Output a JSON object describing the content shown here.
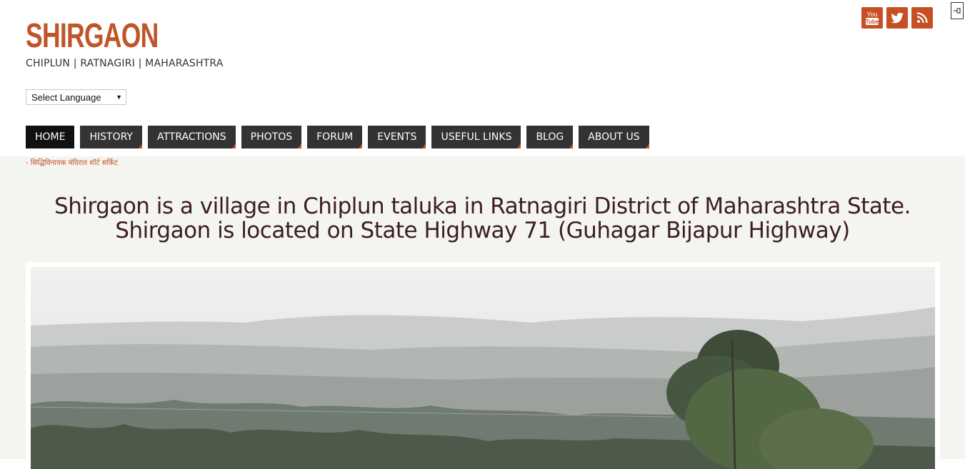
{
  "header": {
    "site_title": "SHIRGAON",
    "tagline": "CHIPLUN | RATNAGIRI | MAHARASHTRA",
    "language_select": {
      "selected": "Select Language"
    },
    "social": [
      {
        "icon": "youtube-icon",
        "label": "You Tube"
      },
      {
        "icon": "twitter-icon"
      },
      {
        "icon": "rss-icon"
      }
    ]
  },
  "nav": {
    "items": [
      {
        "label": "HOME",
        "active": true
      },
      {
        "label": "HISTORY"
      },
      {
        "label": "ATTRACTIONS"
      },
      {
        "label": "PHOTOS"
      },
      {
        "label": "FORUM"
      },
      {
        "label": "EVENTS"
      },
      {
        "label": "USEFUL LINKS"
      },
      {
        "label": "BLOG"
      },
      {
        "label": "ABOUT US"
      }
    ]
  },
  "ticker": {
    "text": "- सिद्धिविनायक मंदिरात शॉर्ट सर्किट"
  },
  "main": {
    "headline_line1": "Shirgaon is a village in Chiplun taluka in Ratnagiri District of Maharashtra State.",
    "headline_line2": "Shirgaon is located on State Highway 71 (Guhagar Bijapur Highway)"
  },
  "colors": {
    "accent": "#c64f26",
    "title": "#c0552a",
    "nav_bg": "#333333",
    "nav_active_bg": "#111111",
    "content_bg": "#f4f4f0",
    "headline": "#3c1e22"
  }
}
